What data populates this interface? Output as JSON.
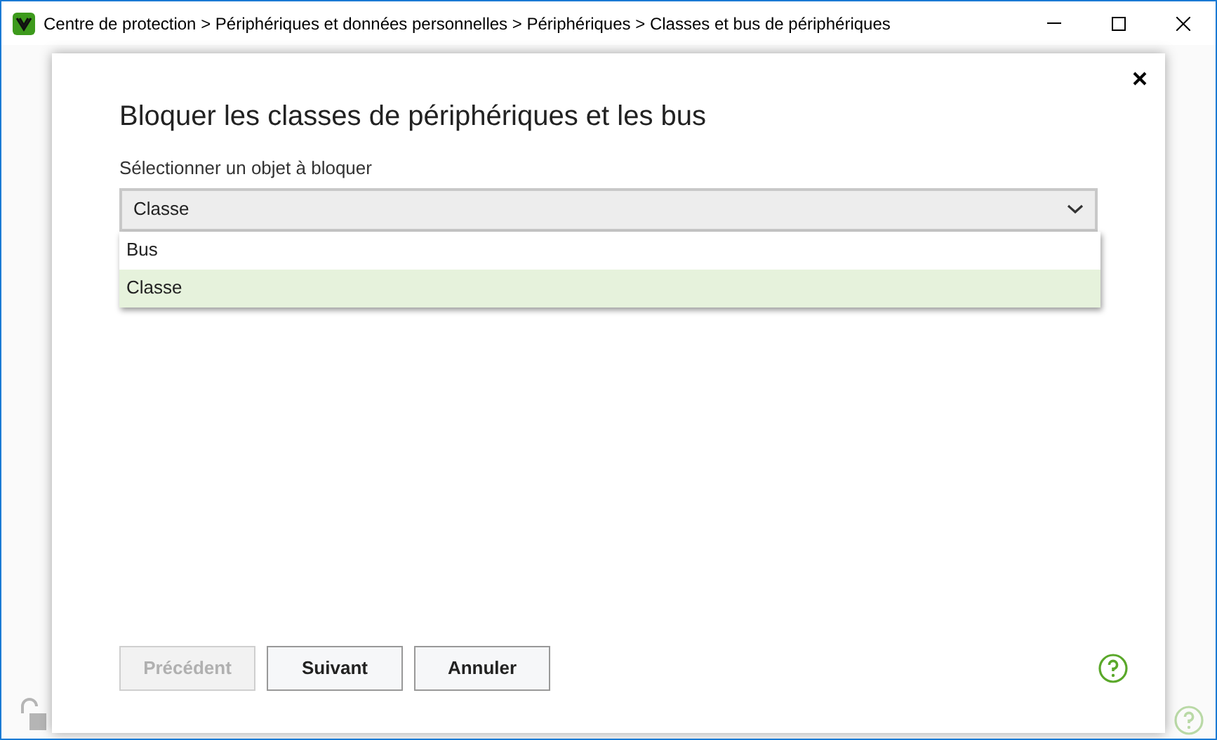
{
  "window": {
    "title": "Centre de protection > Périphériques et données personnelles > Périphériques > Classes et bus de périphériques"
  },
  "dialog": {
    "title": "Bloquer les classes de périphériques et les bus",
    "field_label": "Sélectionner un objet à bloquer",
    "dropdown": {
      "value": "Classe",
      "expanded": true,
      "options": [
        {
          "label": "Bus",
          "selected": false
        },
        {
          "label": "Classe",
          "selected": true
        }
      ]
    },
    "buttons": [
      {
        "label": "Précédent",
        "disabled": true
      },
      {
        "label": "Suivant",
        "disabled": false
      },
      {
        "label": "Annuler",
        "disabled": false
      }
    ]
  }
}
